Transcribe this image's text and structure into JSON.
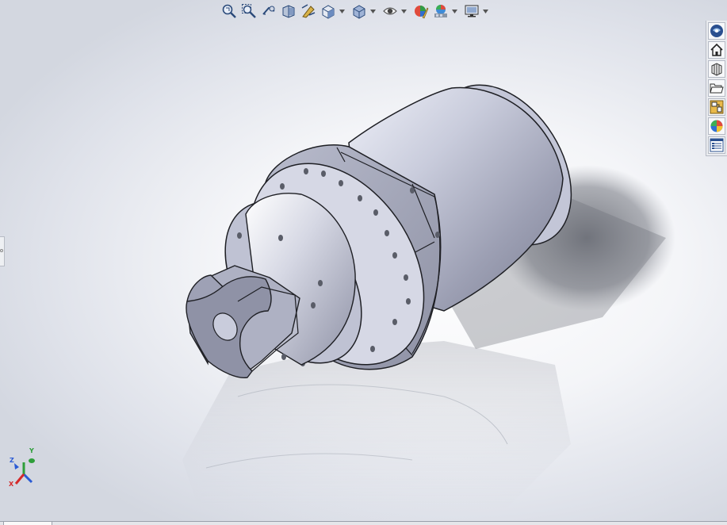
{
  "toolbar": {
    "tools": [
      {
        "icon": "zoom-to-fit-icon"
      },
      {
        "icon": "zoom-to-area-icon"
      },
      {
        "icon": "previous-view-icon"
      },
      {
        "icon": "section-view-icon"
      },
      {
        "icon": "dynamic-annotation-icon"
      },
      {
        "icon": "view-orientation-icon",
        "dropdown": true
      },
      {
        "icon": "display-style-icon",
        "dropdown": true
      },
      {
        "icon": "hide-show-items-icon",
        "dropdown": true
      },
      {
        "icon": "edit-appearance-icon"
      },
      {
        "icon": "apply-scene-icon",
        "dropdown": true
      },
      {
        "icon": "view-settings-icon",
        "dropdown": true
      }
    ]
  },
  "task_pane": {
    "tabs": [
      {
        "icon": "solidworks-resources-icon"
      },
      {
        "icon": "home-icon"
      },
      {
        "icon": "design-library-icon"
      },
      {
        "icon": "file-explorer-icon"
      },
      {
        "icon": "view-palette-icon"
      },
      {
        "icon": "appearances-scenes-icon"
      },
      {
        "icon": "custom-properties-icon"
      }
    ]
  },
  "triad": {
    "x_label": "X",
    "y_label": "Y",
    "z_label": "Z",
    "x_color": "#d42a2a",
    "y_color": "#2e9e3a",
    "z_color": "#2a5ad4"
  },
  "model": {
    "color": "#c4c7d8",
    "edge_color": "#1e1f24"
  }
}
